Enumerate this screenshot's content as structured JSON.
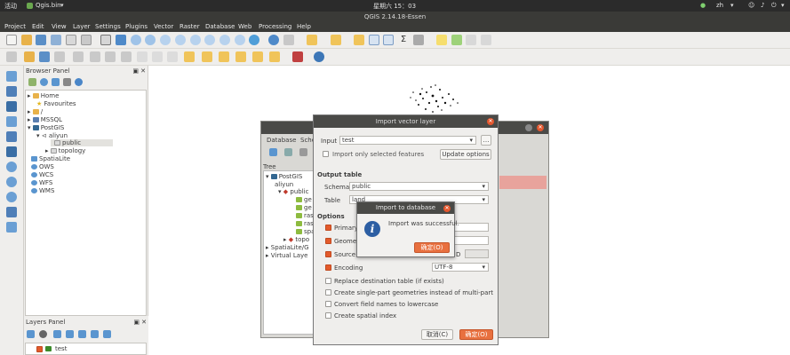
{
  "system": {
    "activities": "活动",
    "app_menu": "Qgis.bin",
    "clock": "星期六 15：03",
    "input_method": "zh"
  },
  "window": {
    "title": "QGIS 2.14.18-Essen"
  },
  "menu": [
    "Project",
    "Edit",
    "View",
    "Layer",
    "Settings",
    "Plugins",
    "Vector",
    "Raster",
    "Database",
    "Web",
    "Processing",
    "Help"
  ],
  "browser": {
    "title": "Browser Panel",
    "items": [
      "Home",
      "Favourites",
      "/",
      "MSSQL",
      "PostGIS",
      "aliyun",
      "public",
      "topology",
      "SpatiaLite",
      "OWS",
      "WCS",
      "WFS",
      "WMS"
    ]
  },
  "layers": {
    "title": "Layers Panel",
    "layer": "test"
  },
  "db_manager": {
    "menu_database": "Database",
    "menu_schema": "Sche",
    "tree_title": "Tree",
    "tree_items": [
      "PostGIS",
      "aliyun",
      "public",
      "ge",
      "ge",
      "ras",
      "ras",
      "spa",
      "topo",
      "SpatiaLite/G",
      "Virtual Laye"
    ]
  },
  "import_dialog": {
    "title": "Import vector layer",
    "input_label": "Input",
    "input_value": "test",
    "only_selected": "Import only selected features",
    "update_options": "Update options",
    "output_table": "Output table",
    "schema_label": "Schema",
    "schema_value": "public",
    "table_label": "Table",
    "table_value": "land",
    "options_title": "Options",
    "opt_primary": "Primary",
    "opt_geometry": "Geomet",
    "opt_source": "Source S",
    "srid_suffix": "D",
    "encoding_label": "Encoding",
    "encoding_value": "UTF-8",
    "opt_replace": "Replace destination table (if exists)",
    "opt_singlepart": "Create single-part geometries instead of multi-part",
    "opt_lowercase": "Convert field names to lowercase",
    "opt_spatial_index": "Create spatial index",
    "cancel": "取消(C)",
    "ok": "确定(O)"
  },
  "message": {
    "title": "Import to database",
    "text": "Import was successful.",
    "ok": "确定(O)"
  }
}
